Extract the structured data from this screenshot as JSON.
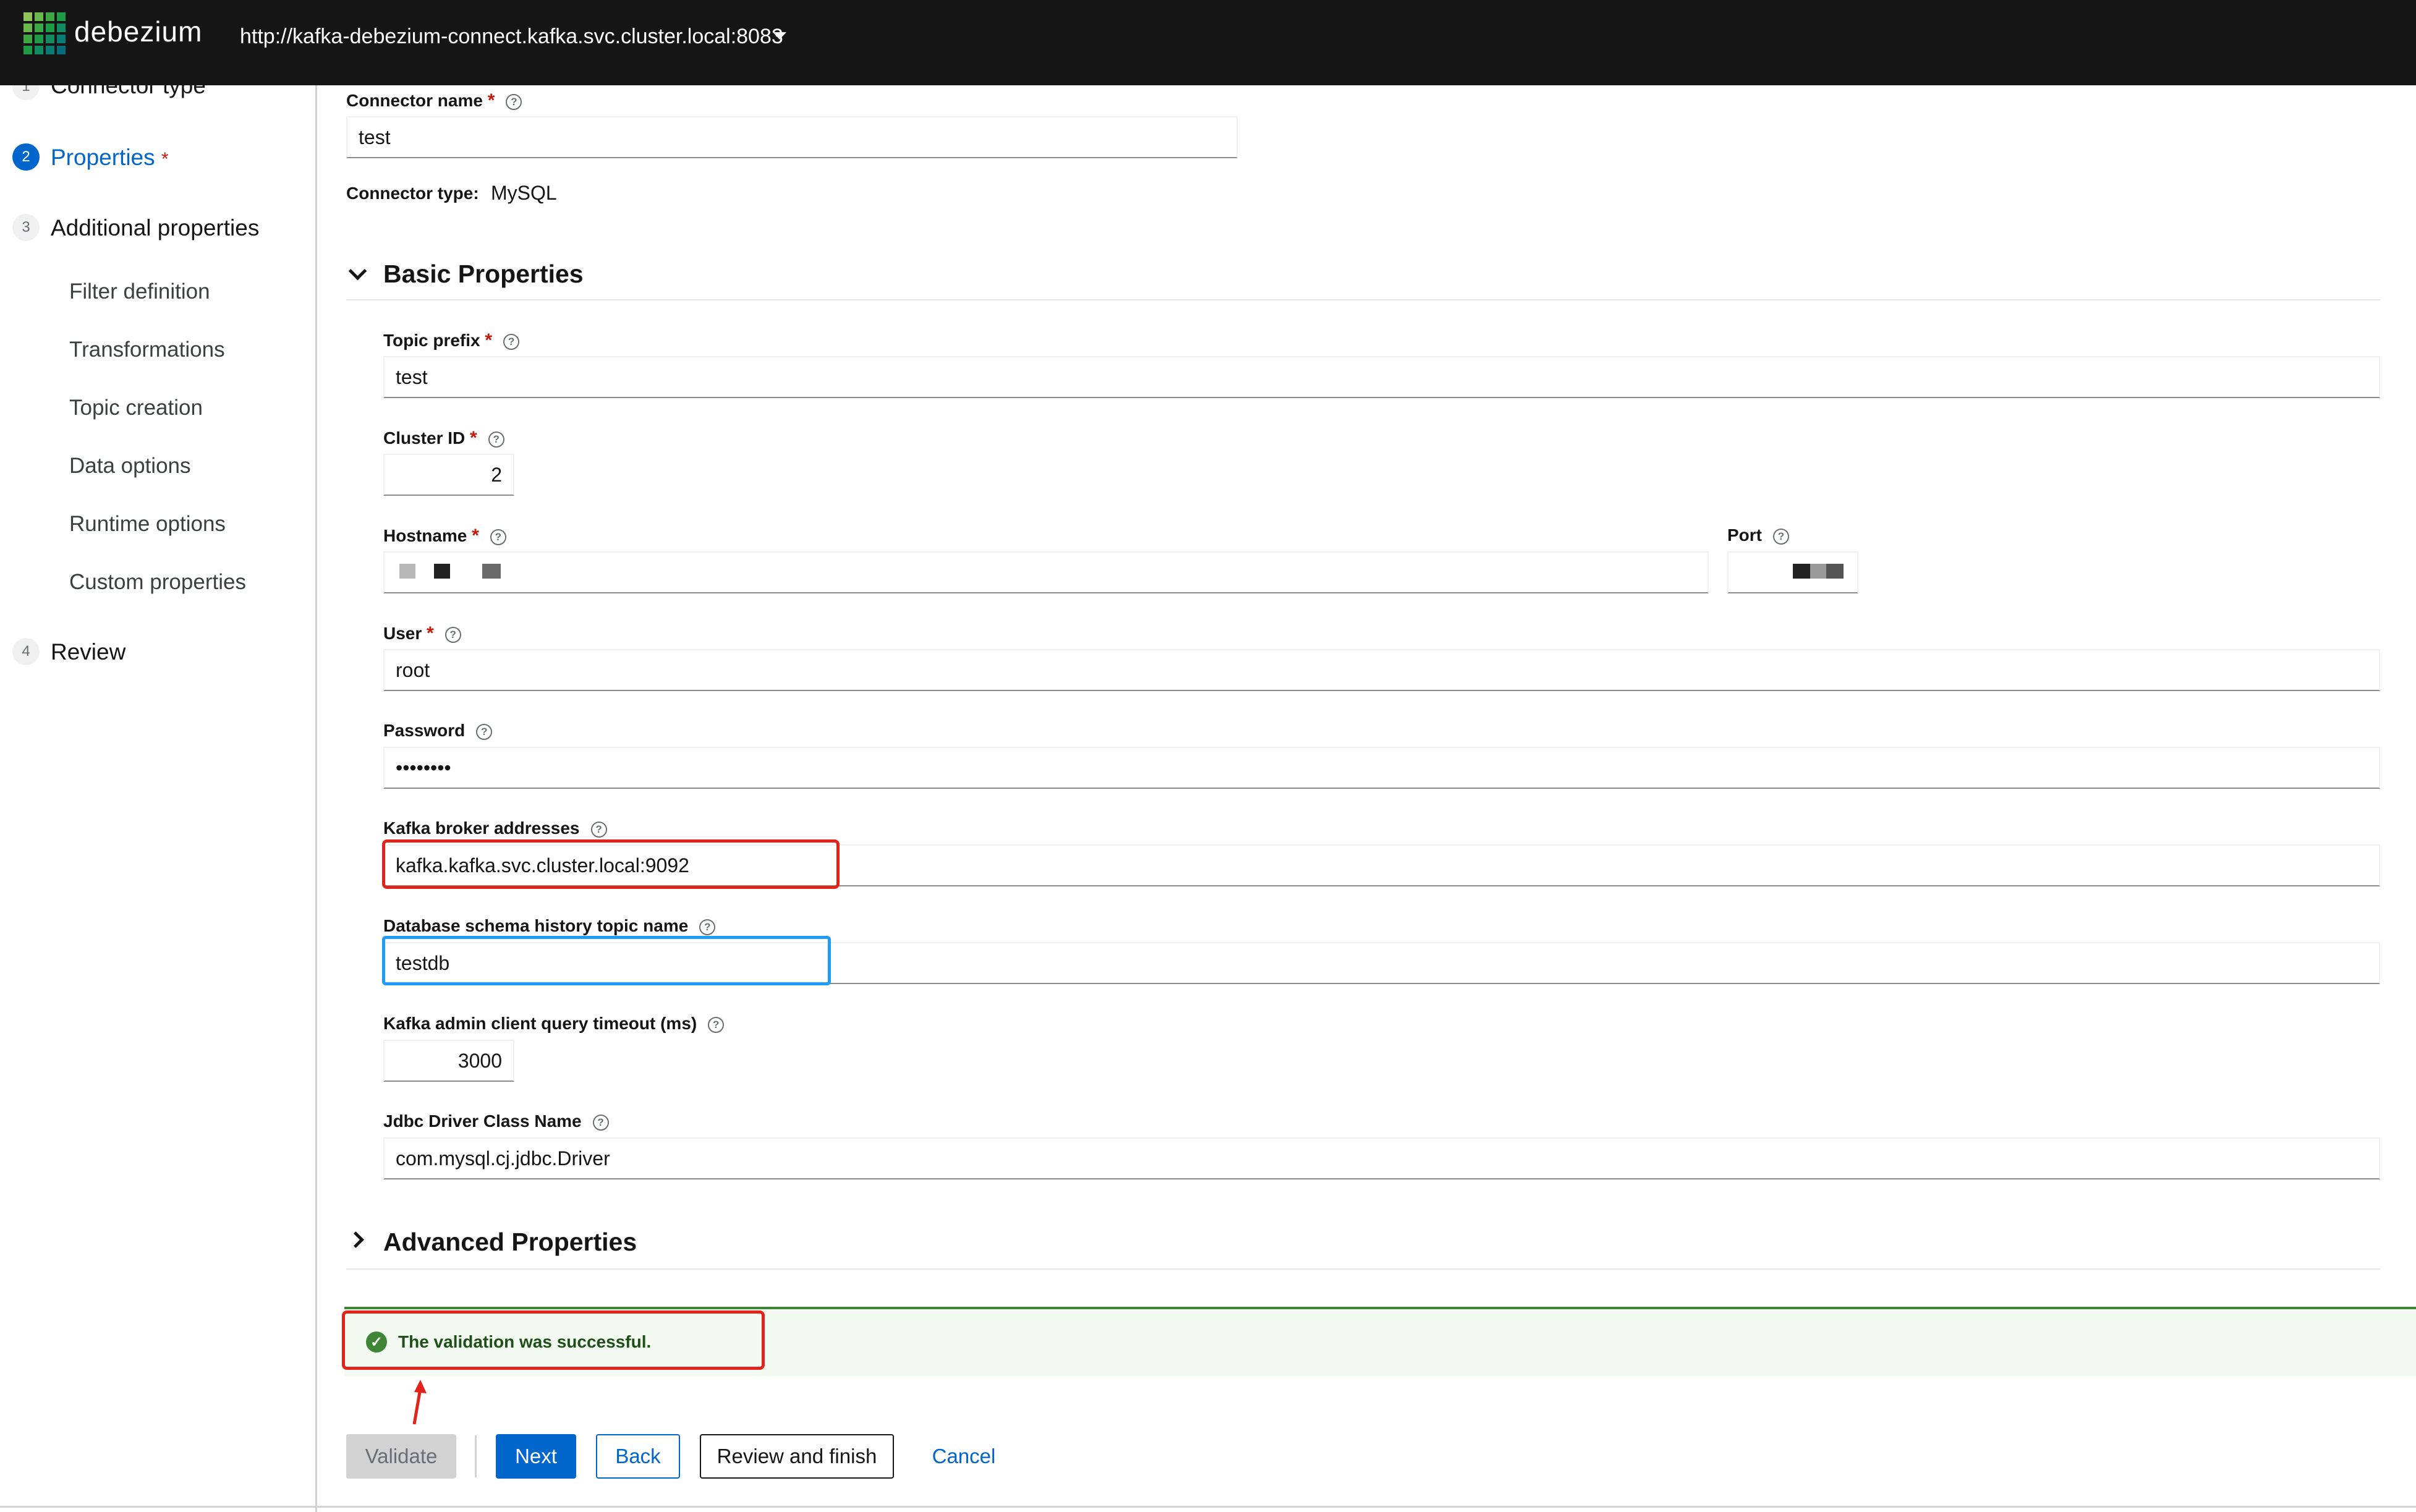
{
  "header": {
    "logo_text": "debezium",
    "connect_url": "http://kafka-debezium-connect.kafka.svc.cluster.local:8083"
  },
  "sidebar": {
    "steps": [
      {
        "number": "1",
        "label": "Connector type"
      },
      {
        "number": "2",
        "label": "Properties",
        "required_mark": "*"
      },
      {
        "number": "3",
        "label": "Additional properties"
      },
      {
        "number": "4",
        "label": "Review"
      }
    ],
    "sub_items": [
      "Filter definition",
      "Transformations",
      "Topic creation",
      "Data options",
      "Runtime options",
      "Custom properties"
    ]
  },
  "form": {
    "connector_name": {
      "label": "Connector name",
      "value": "test",
      "required_mark": "*"
    },
    "connector_type": {
      "label": "Connector type:",
      "value": "MySQL"
    },
    "basic_section": {
      "title": "Basic Properties"
    },
    "topic_prefix": {
      "label": "Topic prefix",
      "value": "test",
      "required_mark": "*"
    },
    "cluster_id": {
      "label": "Cluster ID",
      "value": "2",
      "required_mark": "*"
    },
    "hostname": {
      "label": "Hostname",
      "required_mark": "*"
    },
    "port": {
      "label": "Port"
    },
    "user": {
      "label": "User",
      "value": "root",
      "required_mark": "*"
    },
    "password": {
      "label": "Password",
      "value": "••••••••"
    },
    "kafka_brokers": {
      "label": "Kafka broker addresses",
      "value": "kafka.kafka.svc.cluster.local:9092"
    },
    "schema_history_topic": {
      "label": "Database schema history topic name",
      "value": "testdb"
    },
    "admin_timeout": {
      "label": "Kafka admin client query timeout (ms)",
      "value": "3000"
    },
    "jdbc_driver": {
      "label": "Jdbc Driver Class Name",
      "value": "com.mysql.cj.jdbc.Driver"
    },
    "advanced_section": {
      "title": "Advanced Properties"
    }
  },
  "alert": {
    "message": "The validation was successful."
  },
  "actions": {
    "validate": "Validate",
    "next": "Next",
    "back": "Back",
    "review_finish": "Review and finish",
    "cancel": "Cancel"
  },
  "icons": {
    "help": "question-circle-icon",
    "success": "check-circle-icon"
  },
  "colors": {
    "primary": "#0066cc",
    "success": "#3e8635",
    "required": "#c9190b",
    "annotation_red": "#e2231a",
    "annotation_blue": "#1e9bff",
    "header_bg": "#151515"
  }
}
